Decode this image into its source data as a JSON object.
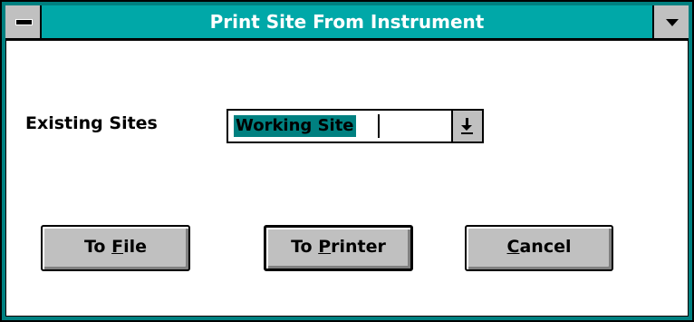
{
  "window": {
    "title": "Print Site From Instrument"
  },
  "form": {
    "existing_sites_label": "Existing Sites",
    "existing_sites_value": "Working Site"
  },
  "buttons": {
    "to_file": {
      "prefix": "To ",
      "accel": "F",
      "suffix": "ile"
    },
    "to_printer": {
      "prefix": "To ",
      "accel": "P",
      "suffix": "rinter"
    },
    "cancel": {
      "prefix": "",
      "accel": "C",
      "suffix": "ancel"
    }
  },
  "colors": {
    "frame": "#008080",
    "title_bar": "#00a8a8",
    "button_face": "#c0c0c0",
    "selection": "#008080"
  },
  "icons": {
    "system_menu": "system-menu-icon",
    "window_menu": "chevron-down-icon",
    "combo_drop": "drop-arrow-icon"
  }
}
